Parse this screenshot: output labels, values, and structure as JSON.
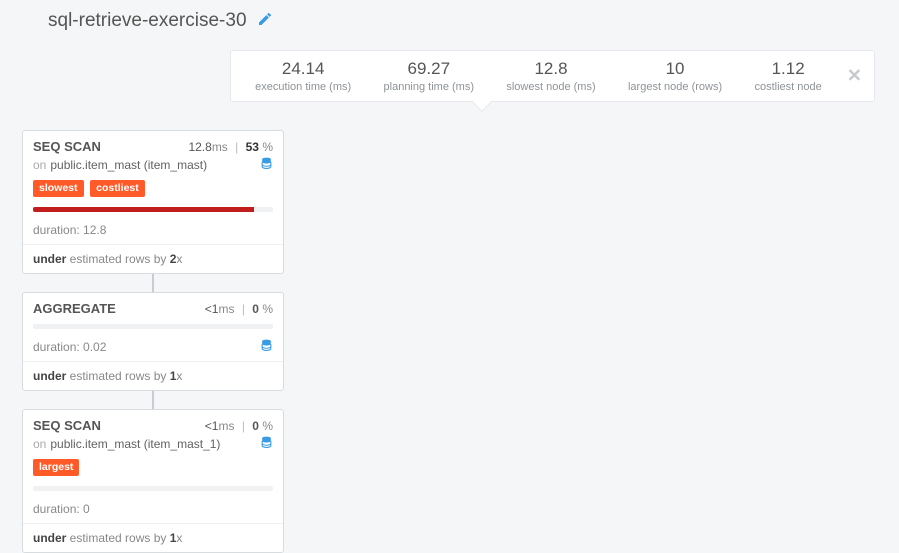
{
  "title": "sql-retrieve-exercise-30",
  "stats": [
    {
      "value": "24.14",
      "label": "execution time (ms)"
    },
    {
      "value": "69.27",
      "label": "planning time (ms)"
    },
    {
      "value": "12.8",
      "label": "slowest node (ms)"
    },
    {
      "value": "10",
      "label": "largest node (rows)"
    },
    {
      "value": "1.12",
      "label": "costliest node"
    }
  ],
  "nodes": [
    {
      "name": "SEQ SCAN",
      "time_val": "12.8",
      "time_unit": "ms",
      "pct": "53",
      "on": "on",
      "relation": "public.item_mast (item_mast)",
      "tags": [
        "slowest",
        "costliest"
      ],
      "bar_pct": 92,
      "duration_label": "duration: ",
      "duration_val": "12.8",
      "estimate_prefix": "under",
      "estimate_mid": " estimated rows by ",
      "estimate_factor": "2",
      "estimate_suffix": "x"
    },
    {
      "name": "AGGREGATE",
      "time_val": "<1",
      "time_unit": "ms",
      "pct": "0",
      "tags": [],
      "bar_pct": 0,
      "duration_label": "duration: ",
      "duration_val": "0.02",
      "estimate_prefix": "under",
      "estimate_mid": " estimated rows by ",
      "estimate_factor": "1",
      "estimate_suffix": "x"
    },
    {
      "name": "SEQ SCAN",
      "time_val": "<1",
      "time_unit": "ms",
      "pct": "0",
      "on": "on",
      "relation": "public.item_mast (item_mast_1)",
      "tags": [
        "largest"
      ],
      "bar_pct": 0,
      "duration_label": "duration: ",
      "duration_val": "0",
      "estimate_prefix": "under",
      "estimate_mid": " estimated rows by ",
      "estimate_factor": "1",
      "estimate_suffix": "x"
    }
  ],
  "pct_sym": "%"
}
